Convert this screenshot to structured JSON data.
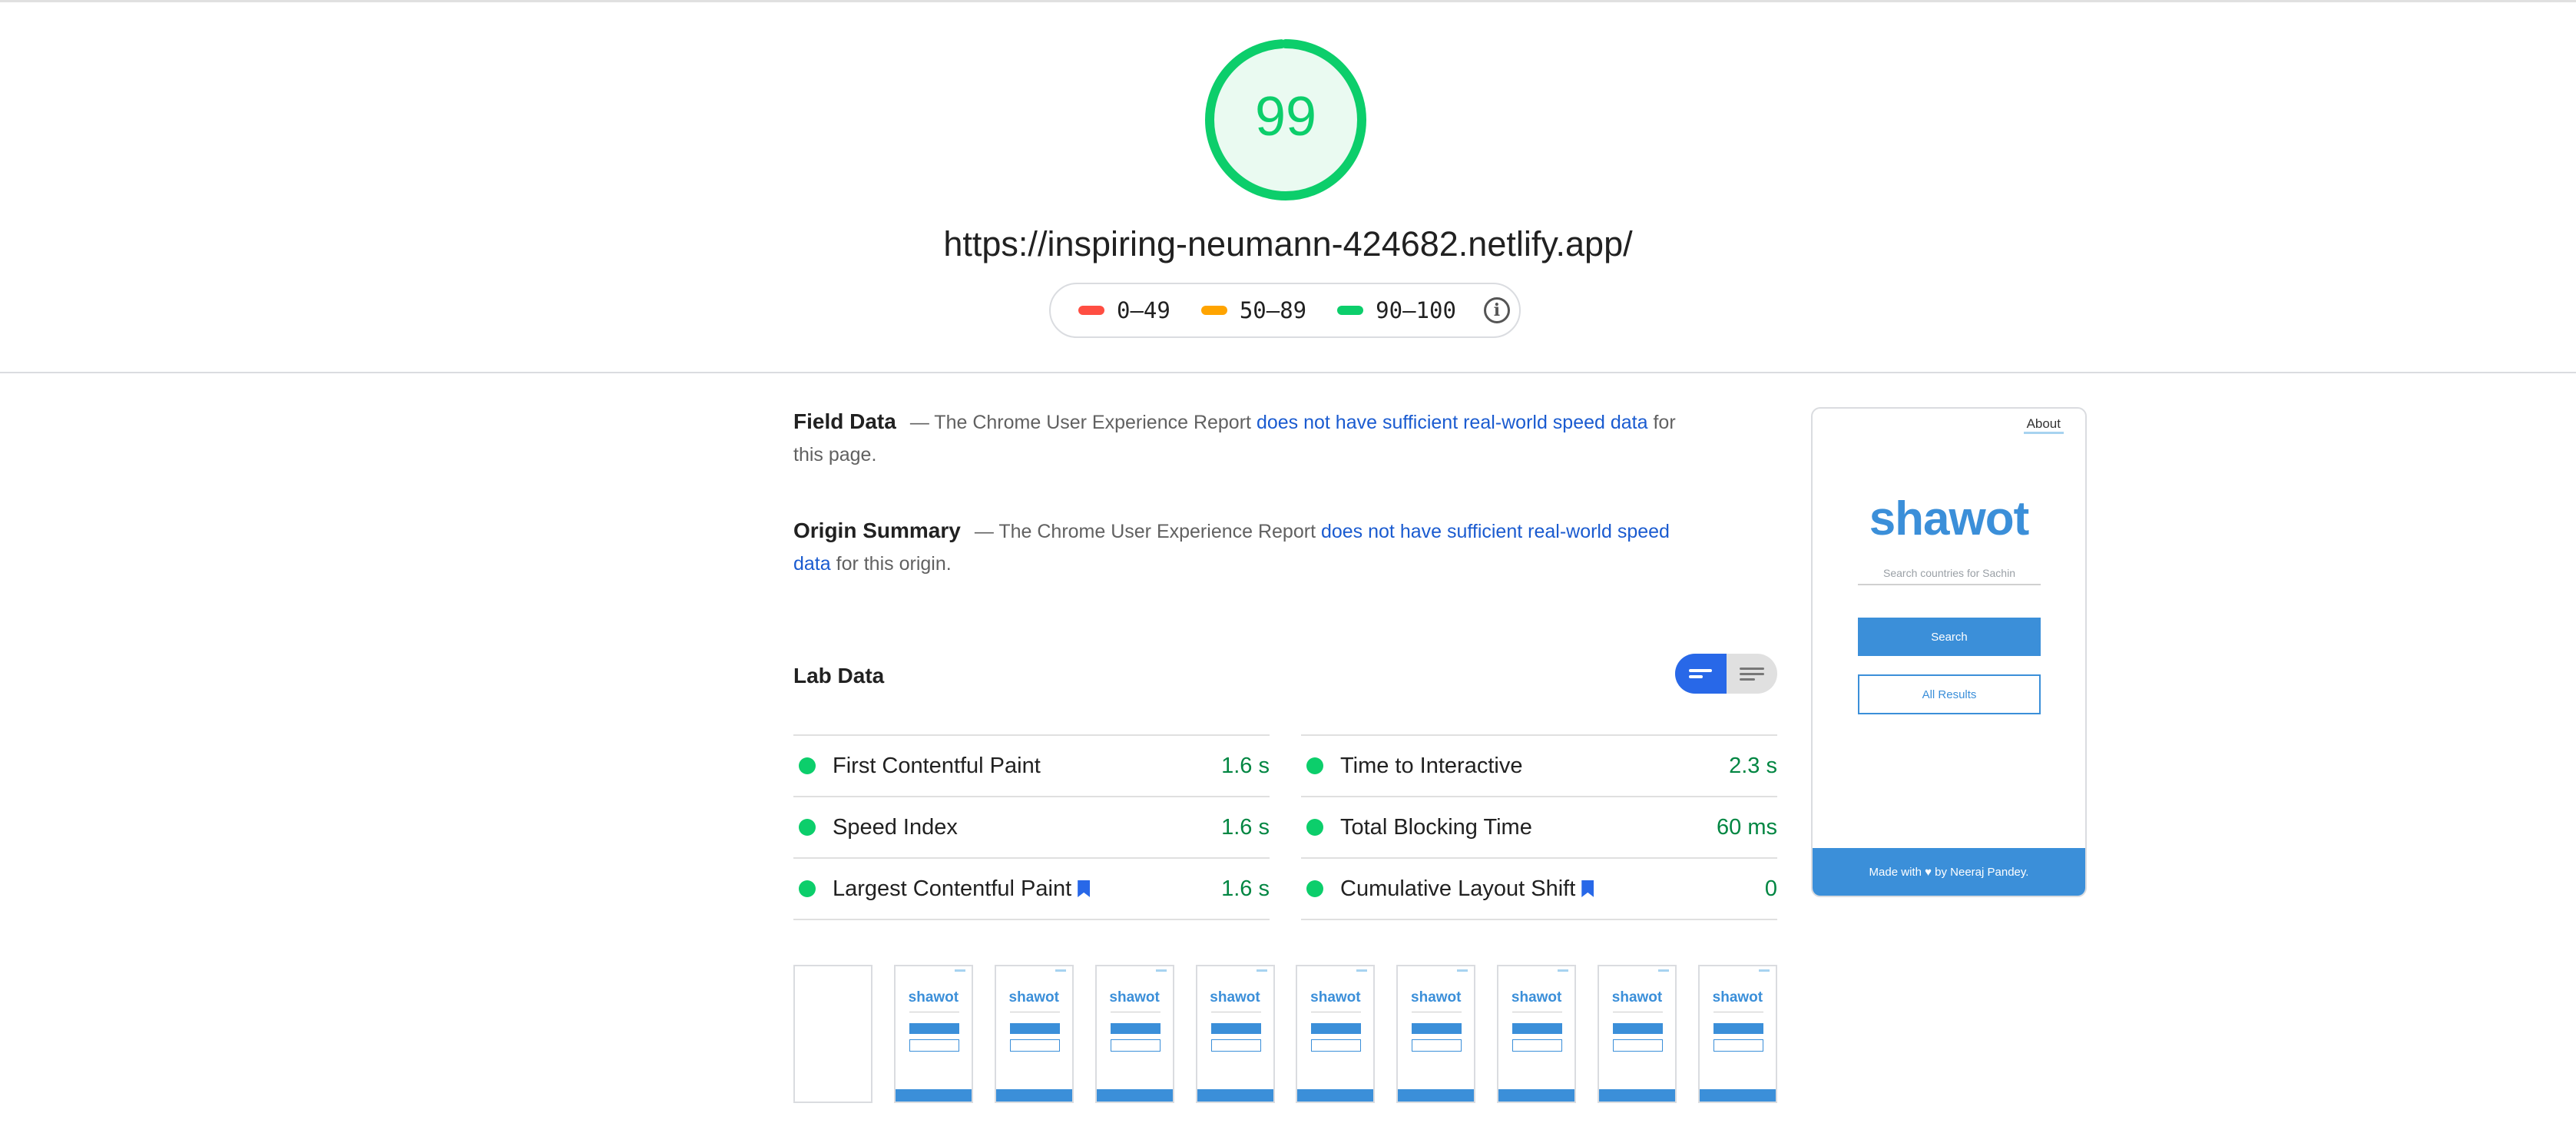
{
  "score": {
    "value": "99",
    "color": "#0cce6b",
    "fill": "#eafaf1",
    "fraction": 0.99
  },
  "url": "https://inspiring-neumann-424682.netlify.app/",
  "legend": [
    {
      "label": "0–49",
      "color": "#ff4e42"
    },
    {
      "label": "50–89",
      "color": "#ffa400"
    },
    {
      "label": "90–100",
      "color": "#0cce6b"
    }
  ],
  "field": {
    "title": "Field Data",
    "pre": "— The Chrome User Experience Report ",
    "link": "does not have sufficient real-world speed data",
    "post": " for this page."
  },
  "origin": {
    "title": "Origin Summary",
    "pre": "— The Chrome User Experience Report ",
    "link": "does not have sufficient real-world speed data",
    "post": " for this origin."
  },
  "lab": {
    "title": "Lab Data",
    "left": [
      {
        "name": "First Contentful Paint",
        "value": "1.6 s"
      },
      {
        "name": "Speed Index",
        "value": "1.6 s"
      },
      {
        "name": "Largest Contentful Paint",
        "value": "1.6 s"
      }
    ],
    "right": [
      {
        "name": "Time to Interactive",
        "value": "2.3 s"
      },
      {
        "name": "Total Blocking Time",
        "value": "60 ms"
      },
      {
        "name": "Cumulative Layout Shift",
        "value": "0"
      }
    ]
  },
  "screenshot": {
    "about": "About",
    "logo": "shawot",
    "placeholder": "Search countries for Sachin",
    "search": "Search",
    "all_results": "All Results",
    "footer": "Made with ♥ by Neeraj Pandey."
  },
  "filmstrip": {
    "logo": "shawot",
    "frames": [
      false,
      true,
      true,
      true,
      true,
      true,
      true,
      true,
      true,
      true
    ]
  }
}
